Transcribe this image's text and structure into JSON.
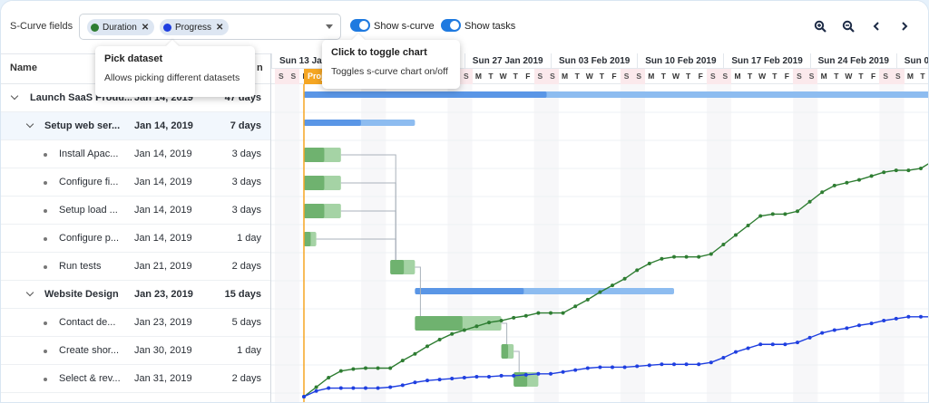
{
  "toolbar": {
    "fields_label": "S-Curve fields",
    "chips": [
      {
        "label": "Duration",
        "color": "#2e7d32"
      },
      {
        "label": "Progress",
        "color": "#1f3fe0"
      }
    ],
    "show_scurve_label": "Show s-curve",
    "show_tasks_label": "Show tasks",
    "zoom_in_icon": "zoom-in-icon",
    "zoom_out_icon": "zoom-out-icon",
    "prev_icon": "chevron-left-icon",
    "next_icon": "chevron-right-icon"
  },
  "tooltips": {
    "dataset": {
      "title": "Pick dataset",
      "body": "Allows picking different datasets"
    },
    "toggle": {
      "title": "Click to toggle chart",
      "body": "Toggles s-curve chart on/off"
    }
  },
  "grid": {
    "col_name": "Name",
    "col_duration": "n",
    "rows": [
      {
        "name": "Launch SaaS Produ...",
        "date": "Jan 14, 2019",
        "duration": "47 days",
        "level": 0,
        "parent": true
      },
      {
        "name": "Setup web ser...",
        "date": "Jan 14, 2019",
        "duration": "7 days",
        "level": 1,
        "parent": true,
        "selected": true
      },
      {
        "name": "Install Apac...",
        "date": "Jan 14, 2019",
        "duration": "3 days",
        "level": 2
      },
      {
        "name": "Configure fi...",
        "date": "Jan 14, 2019",
        "duration": "3 days",
        "level": 2
      },
      {
        "name": "Setup load ...",
        "date": "Jan 14, 2019",
        "duration": "3 days",
        "level": 2
      },
      {
        "name": "Configure p...",
        "date": "Jan 14, 2019",
        "duration": "1 day",
        "level": 2
      },
      {
        "name": "Run tests",
        "date": "Jan 21, 2019",
        "duration": "2 days",
        "level": 2
      },
      {
        "name": "Website Design",
        "date": "Jan 23, 2019",
        "duration": "15 days",
        "level": 1,
        "parent": true
      },
      {
        "name": "Contact de...",
        "date": "Jan 23, 2019",
        "duration": "5 days",
        "level": 2
      },
      {
        "name": "Create shor...",
        "date": "Jan 30, 2019",
        "duration": "1 day",
        "level": 2
      },
      {
        "name": "Select & rev...",
        "date": "Jan 31, 2019",
        "duration": "2 days",
        "level": 2
      }
    ]
  },
  "timeline": {
    "weeks": [
      "Sun 13 Jan",
      "Sun 20 Jan 2019",
      "Sun 27 Jan 2019",
      "Sun 03 Feb 2019",
      "Sun 10 Feb 2019",
      "Sun 17 Feb 2019",
      "Sun 24 Feb 2019",
      "Sun 03 M"
    ],
    "day_letters": [
      "S",
      "M",
      "T",
      "W",
      "T",
      "F",
      "S"
    ],
    "project_start_label": "Project st",
    "colors": {
      "summary": "#5a96e6",
      "task": "#6fb26f",
      "task_light": "#a5d3a5",
      "weekend": "#fbe9ec",
      "duration_curve": "#2e7d32",
      "progress_curve": "#1f3fe0",
      "project_line": "#f5a623"
    }
  },
  "chart_data": {
    "type": "line",
    "series": [
      {
        "name": "Duration",
        "values": [
          0,
          10,
          20,
          27,
          29,
          30,
          30,
          30,
          38,
          45,
          53,
          60,
          66,
          70,
          74,
          78,
          80,
          83,
          85,
          88,
          88,
          88,
          95,
          102,
          110,
          117,
          124,
          133,
          140,
          145,
          147,
          147,
          147,
          150,
          160,
          170,
          180,
          190,
          192,
          192,
          195,
          205,
          215,
          222,
          225,
          228,
          232,
          236,
          238,
          238,
          240,
          248,
          255,
          258,
          265,
          268,
          275,
          283,
          290,
          293,
          296,
          296,
          300,
          303,
          310
        ]
      },
      {
        "name": "Progress",
        "values": [
          0,
          6,
          9,
          9,
          9,
          9,
          9,
          10,
          12,
          15,
          17,
          18,
          19,
          20,
          21,
          21,
          22,
          22,
          23,
          24,
          24,
          26,
          28,
          30,
          31,
          31,
          31,
          32,
          33,
          34,
          34,
          34,
          34,
          36,
          41,
          47,
          51,
          55,
          55,
          55,
          57,
          62,
          67,
          70,
          72,
          75,
          77,
          80,
          82,
          84,
          84,
          84,
          87,
          89,
          92,
          92,
          92,
          93,
          93,
          93,
          93,
          93,
          93,
          93,
          93
        ]
      }
    ],
    "xlabel": "",
    "ylabel": ""
  }
}
